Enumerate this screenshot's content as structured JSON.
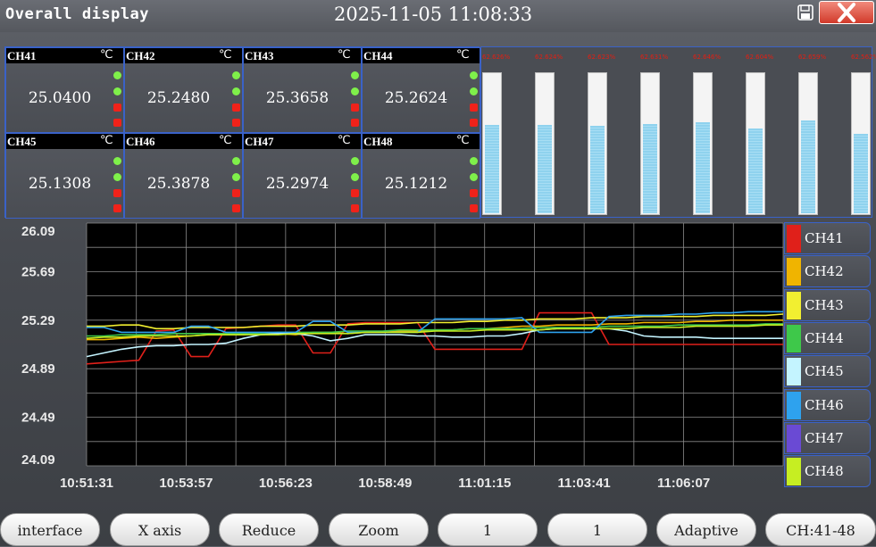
{
  "header": {
    "title": "Overall display",
    "datetime": "2025-11-05 11:08:33"
  },
  "channels": [
    {
      "name": "CH41",
      "unit": "℃",
      "value": "25.0400"
    },
    {
      "name": "CH42",
      "unit": "℃",
      "value": "25.2480"
    },
    {
      "name": "CH43",
      "unit": "℃",
      "value": "25.3658"
    },
    {
      "name": "CH44",
      "unit": "℃",
      "value": "25.2624"
    },
    {
      "name": "CH45",
      "unit": "℃",
      "value": "25.1308"
    },
    {
      "name": "CH46",
      "unit": "℃",
      "value": "25.3878"
    },
    {
      "name": "CH47",
      "unit": "℃",
      "value": "25.2974"
    },
    {
      "name": "CH48",
      "unit": "℃",
      "value": "25.1212"
    }
  ],
  "gauges": [
    {
      "label": "62.626%",
      "fill": 0.626
    },
    {
      "label": "62.624%",
      "fill": 0.624
    },
    {
      "label": "62.623%",
      "fill": 0.623
    },
    {
      "label": "62.631%",
      "fill": 0.631
    },
    {
      "label": "62.646%",
      "fill": 0.646
    },
    {
      "label": "62.604%",
      "fill": 0.604
    },
    {
      "label": "62.659%",
      "fill": 0.659
    },
    {
      "label": "62.562%",
      "fill": 0.562
    }
  ],
  "legend": [
    {
      "name": "CH41",
      "color": "#e0201a"
    },
    {
      "name": "CH42",
      "color": "#f0b400"
    },
    {
      "name": "CH43",
      "color": "#f2ef30"
    },
    {
      "name": "CH44",
      "color": "#3ec84a"
    },
    {
      "name": "CH45",
      "color": "#c4f4ff"
    },
    {
      "name": "CH46",
      "color": "#2ea2ee"
    },
    {
      "name": "CH47",
      "color": "#6a4ad4"
    },
    {
      "name": "CH48",
      "color": "#c6ee22"
    }
  ],
  "buttons": {
    "interface": "interface",
    "x_axis": "X axis",
    "reduce": "Reduce",
    "zoom": "Zoom",
    "value1": "1",
    "value2": "1",
    "adaptive": "Adaptive",
    "channel_range": "CH:41-48"
  },
  "chart_data": {
    "type": "line",
    "y_ticks": [
      "26.09",
      "25.69",
      "25.29",
      "24.89",
      "24.49",
      "24.09"
    ],
    "x_ticks": [
      "10:51:31",
      "10:53:57",
      "10:56:23",
      "10:58:49",
      "11:01:15",
      "11:03:41",
      "11:06:07"
    ],
    "ylim": [
      24.09,
      26.09
    ],
    "grid": true,
    "x": [
      0,
      1,
      2,
      3,
      4,
      5,
      6,
      7,
      8,
      9,
      10,
      11,
      12,
      13,
      14,
      15,
      16,
      17,
      18,
      19,
      20,
      21,
      22,
      23,
      24,
      25,
      26,
      27,
      28,
      29,
      30,
      31,
      32,
      33,
      34,
      35,
      36,
      37,
      38,
      39,
      40
    ],
    "series": [
      {
        "name": "CH41",
        "color": "#e0201a",
        "values": [
          24.93,
          24.94,
          24.95,
          24.96,
          25.2,
          25.21,
          24.99,
          24.99,
          25.22,
          25.23,
          25.24,
          25.25,
          25.25,
          25.02,
          25.02,
          25.26,
          25.27,
          25.27,
          25.27,
          25.27,
          25.05,
          25.05,
          25.05,
          25.05,
          25.05,
          25.05,
          25.35,
          25.35,
          25.35,
          25.35,
          25.09,
          25.09,
          25.09,
          25.09,
          25.09,
          25.09,
          25.09,
          25.09,
          25.09,
          25.09,
          25.09
        ]
      },
      {
        "name": "CH42",
        "color": "#f0b400",
        "values": [
          25.13,
          25.13,
          25.14,
          25.15,
          25.14,
          25.15,
          25.16,
          25.17,
          25.17,
          25.17,
          25.18,
          25.18,
          25.17,
          25.19,
          25.19,
          25.18,
          25.19,
          25.19,
          25.2,
          25.2,
          25.21,
          25.21,
          25.22,
          25.22,
          25.23,
          25.24,
          25.24,
          25.25,
          25.25,
          25.25,
          25.26,
          25.26,
          25.27,
          25.27,
          25.27,
          25.28,
          25.28,
          25.29,
          25.29,
          25.29,
          25.29
        ]
      },
      {
        "name": "CH43",
        "color": "#f2ef30",
        "values": [
          25.24,
          25.24,
          25.25,
          25.25,
          25.22,
          25.22,
          25.23,
          25.23,
          25.23,
          25.23,
          25.24,
          25.24,
          25.24,
          25.25,
          25.25,
          25.25,
          25.26,
          25.26,
          25.26,
          25.27,
          25.27,
          25.27,
          25.28,
          25.28,
          25.29,
          25.29,
          25.3,
          25.3,
          25.3,
          25.31,
          25.31,
          25.31,
          25.32,
          25.32,
          25.32,
          25.32,
          25.33,
          25.33,
          25.33,
          25.33,
          25.34
        ]
      },
      {
        "name": "CH44",
        "color": "#3ec84a",
        "values": [
          25.16,
          25.16,
          25.17,
          25.17,
          25.17,
          25.18,
          25.18,
          25.18,
          25.18,
          25.18,
          25.18,
          25.19,
          25.19,
          25.19,
          25.19,
          25.2,
          25.2,
          25.2,
          25.21,
          25.21,
          25.21,
          25.21,
          25.22,
          25.22,
          25.22,
          25.22,
          25.23,
          25.23,
          25.23,
          25.23,
          25.24,
          25.24,
          25.24,
          25.24,
          25.25,
          25.25,
          25.25,
          25.25,
          25.25,
          25.26,
          25.26
        ]
      },
      {
        "name": "CH45",
        "color": "#c4f4ff",
        "values": [
          24.99,
          25.02,
          25.05,
          25.07,
          25.08,
          25.08,
          25.09,
          25.09,
          25.1,
          25.14,
          25.17,
          25.18,
          25.18,
          25.16,
          25.12,
          25.14,
          25.17,
          25.17,
          25.17,
          25.16,
          25.16,
          25.15,
          25.15,
          25.16,
          25.16,
          25.18,
          25.21,
          25.22,
          25.22,
          25.22,
          25.22,
          25.2,
          25.16,
          25.15,
          25.15,
          25.15,
          25.14,
          25.14,
          25.14,
          25.14,
          25.14
        ]
      },
      {
        "name": "CH46",
        "color": "#2ea2ee",
        "values": [
          25.23,
          25.23,
          25.19,
          25.19,
          25.19,
          25.19,
          25.24,
          25.24,
          25.19,
          25.19,
          25.19,
          25.19,
          25.19,
          25.28,
          25.28,
          25.19,
          25.19,
          25.19,
          25.19,
          25.19,
          25.3,
          25.3,
          25.3,
          25.3,
          25.3,
          25.31,
          25.19,
          25.19,
          25.19,
          25.19,
          25.32,
          25.33,
          25.33,
          25.33,
          25.34,
          25.34,
          25.35,
          25.35,
          25.36,
          25.36,
          25.36
        ]
      },
      {
        "name": "CH47",
        "color": "#6a4ad4",
        "values": []
      },
      {
        "name": "CH48",
        "color": "#c6ee22",
        "values": [
          25.14,
          25.15,
          25.15,
          25.16,
          25.16,
          25.16,
          25.16,
          25.17,
          25.17,
          25.17,
          25.17,
          25.17,
          25.18,
          25.18,
          25.18,
          25.18,
          25.19,
          25.19,
          25.19,
          25.19,
          25.2,
          25.2,
          25.2,
          25.21,
          25.21,
          25.21,
          25.21,
          25.22,
          25.22,
          25.22,
          25.22,
          25.22,
          25.23,
          25.23,
          25.23,
          25.24,
          25.24,
          25.24,
          25.24,
          25.25,
          25.25
        ]
      }
    ]
  }
}
